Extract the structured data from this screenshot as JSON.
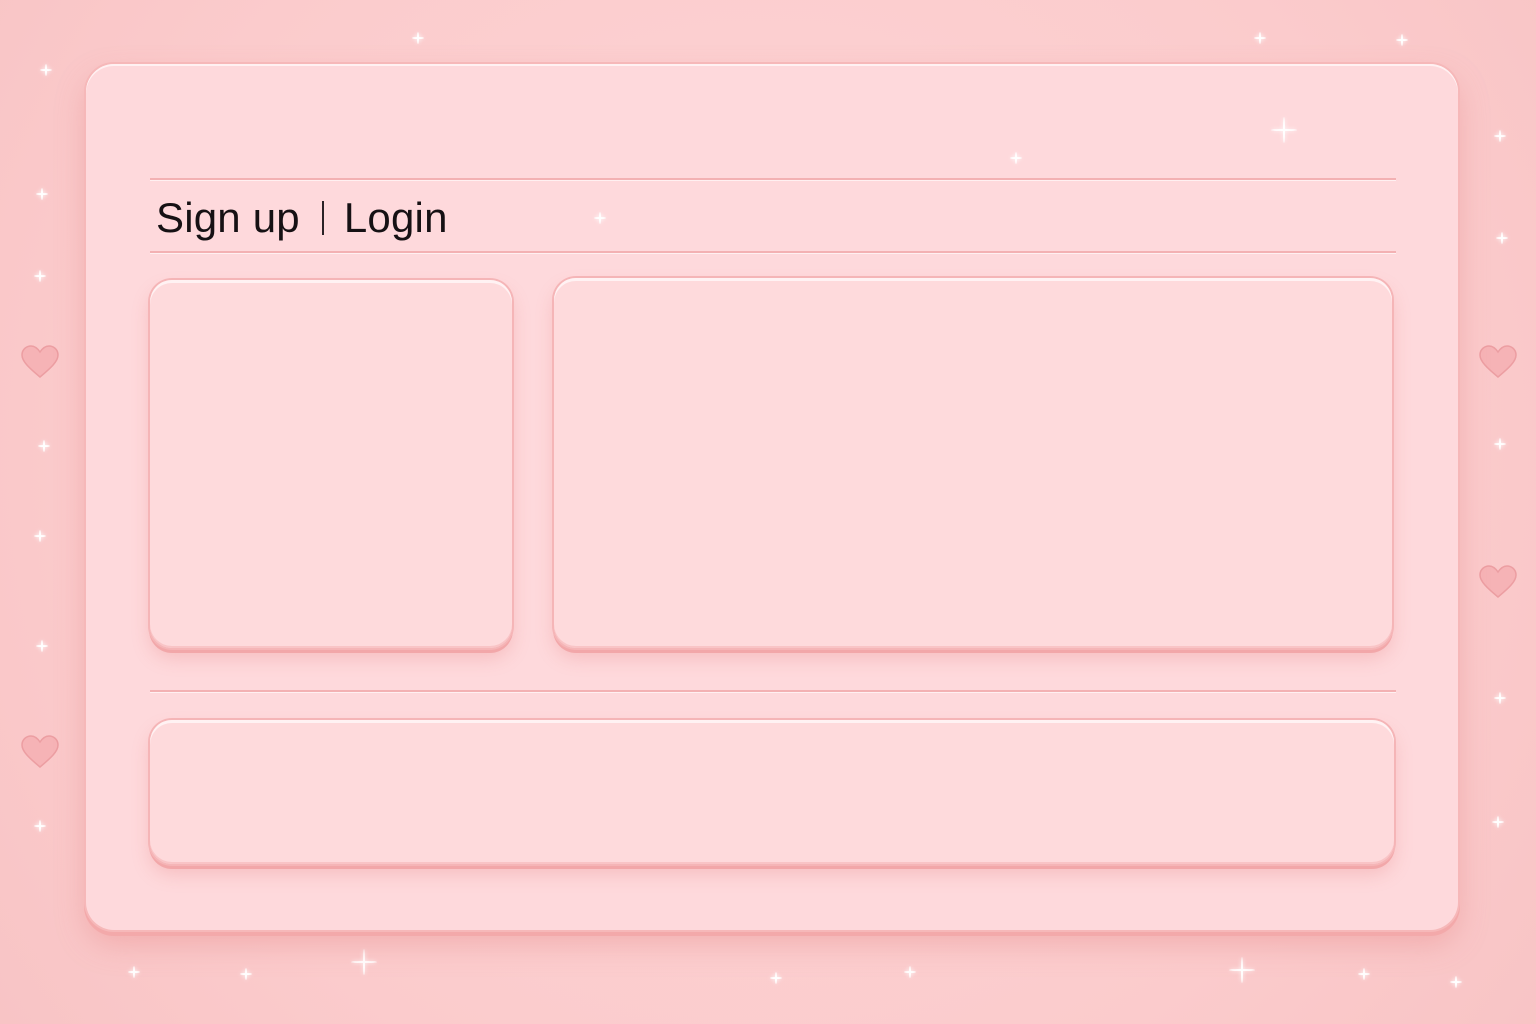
{
  "auth": {
    "signup_label": "Sign up",
    "login_label": "Login"
  },
  "theme": {
    "background": "#fbcfcf",
    "panel": "#fedadc",
    "border": "#f5b5b7",
    "heart": "#f4a7ab",
    "text": "#161114"
  },
  "decorations": {
    "sparkle_icon": "sparkle-icon",
    "heart_icon": "heart-icon"
  }
}
